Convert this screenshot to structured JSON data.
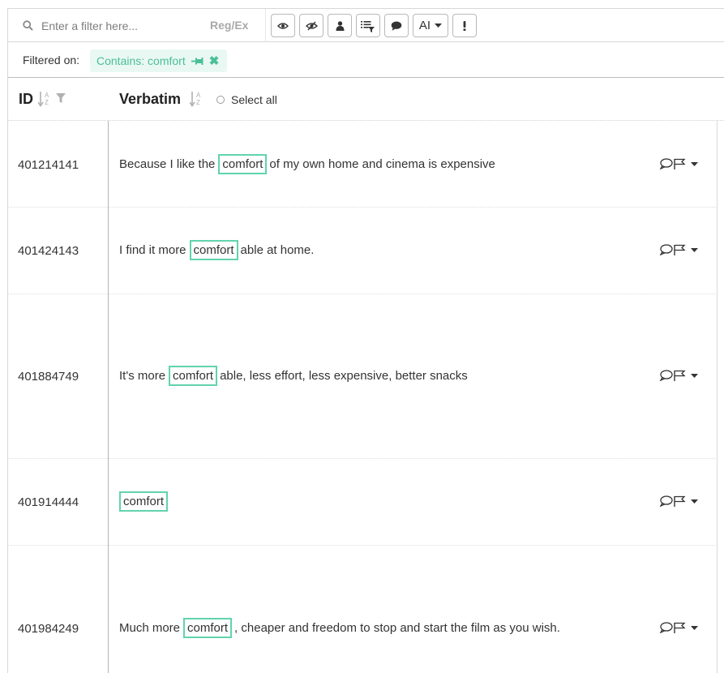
{
  "toolbar": {
    "search_placeholder": "Enter a filter here...",
    "regex_label": "Reg/Ex",
    "buttons": [
      "eye-icon",
      "eye-slash-icon",
      "user-icon",
      "list-filter-icon",
      "comment-icon",
      "ai-dropdown",
      "exclamation-icon"
    ],
    "ai_label": "AI"
  },
  "filterbar": {
    "label": "Filtered on:",
    "chip_text": "Contains: comfort"
  },
  "header": {
    "id_label": "ID",
    "verbatim_label": "Verbatim",
    "select_all_label": "Select all"
  },
  "rows": [
    {
      "id": "401214141",
      "before": "Because I like the",
      "match": "comfort",
      "after": "of my own home and cinema is expensive"
    },
    {
      "id": "401424143",
      "before": "I find it more",
      "match": "comfort",
      "after": "able at home."
    },
    {
      "id": "401884749",
      "before": "It's more",
      "match": "comfort",
      "after": "able, less effort, less expensive, better snacks"
    },
    {
      "id": "401914444",
      "before": "",
      "match": "comfort",
      "after": ""
    },
    {
      "id": "401984249",
      "before": "Much more",
      "match": "comfort",
      "after": ", cheaper and freedom to stop and start the film as you wish."
    }
  ],
  "colors": {
    "accent": "#62d3ad",
    "chip_bg": "#e9f8f3",
    "chip_text": "#4bbf96"
  }
}
